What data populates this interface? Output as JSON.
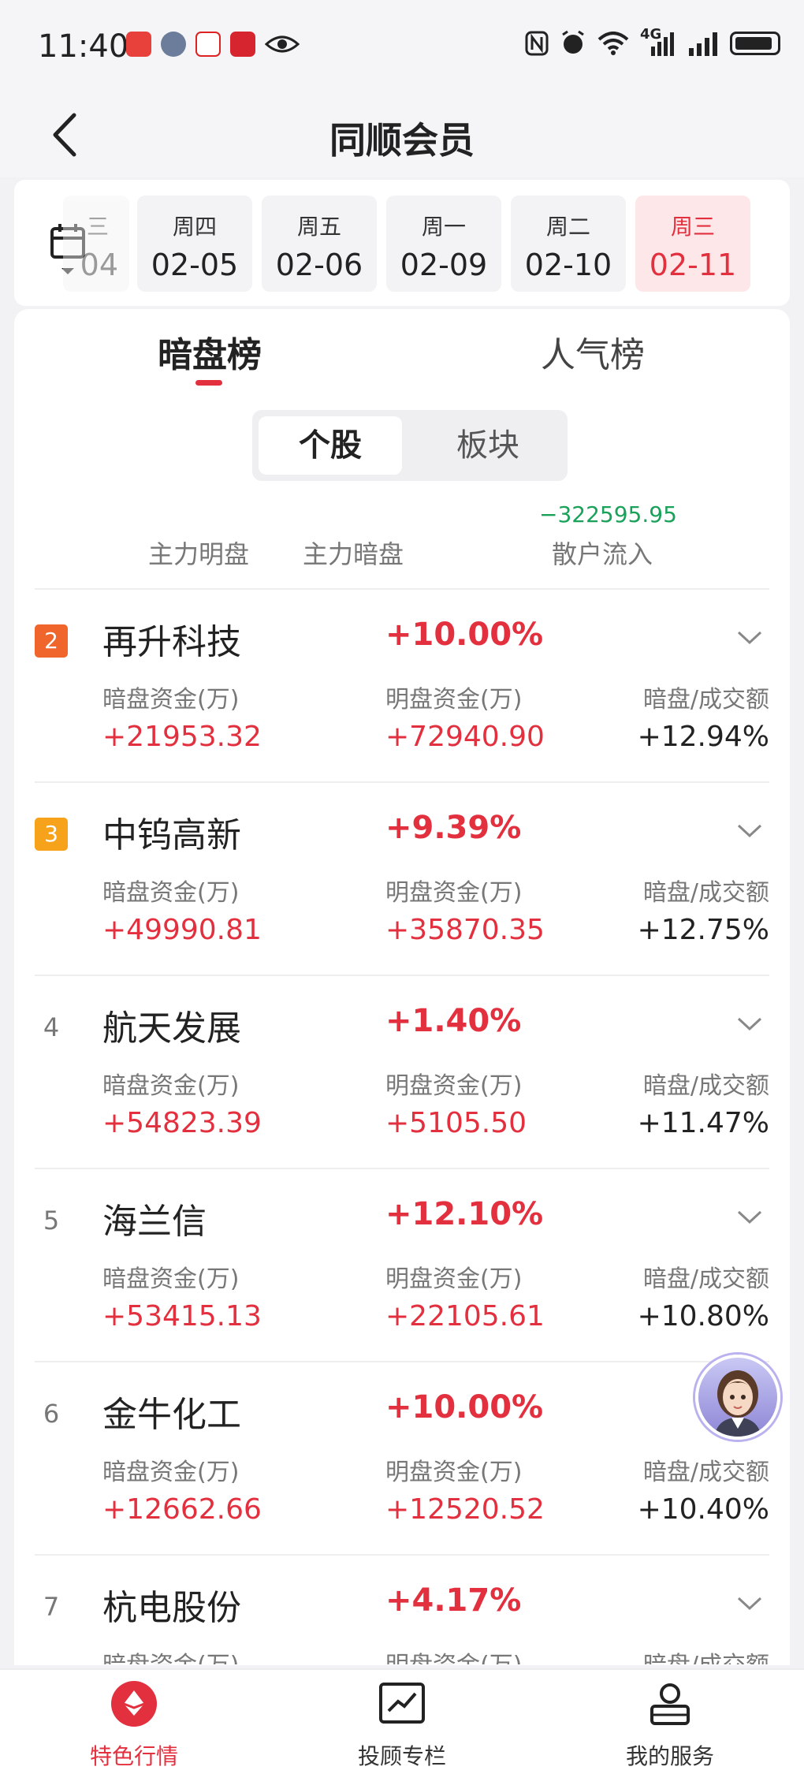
{
  "status_bar": {
    "time": "11:40",
    "network": "4G"
  },
  "header": {
    "title": "同顺会员"
  },
  "date_strip": {
    "dates": [
      {
        "dow": "三",
        "date": "04",
        "state": "partial"
      },
      {
        "dow": "周四",
        "date": "02-05",
        "state": "normal"
      },
      {
        "dow": "周五",
        "date": "02-06",
        "state": "normal"
      },
      {
        "dow": "周一",
        "date": "02-09",
        "state": "normal"
      },
      {
        "dow": "周二",
        "date": "02-10",
        "state": "normal"
      },
      {
        "dow": "周三",
        "date": "02-11",
        "state": "active"
      }
    ]
  },
  "tabs": {
    "dark_pool": "暗盘榜",
    "popularity": "人气榜"
  },
  "segment": {
    "stocks": "个股",
    "sectors": "板块"
  },
  "flow_summary": {
    "retail_value": "−322595.95",
    "main_ming_label": "主力明盘",
    "main_an_label": "主力暗盘",
    "retail_label": "散户流入"
  },
  "column_labels": {
    "dark_funds": "暗盘资金(万)",
    "open_funds": "明盘资金(万)",
    "dark_ratio": "暗盘/成交额"
  },
  "stocks": [
    {
      "rank": "2",
      "name": "再升科技",
      "pct": "+10.00%",
      "dark": "+21953.32",
      "open": "+72940.90",
      "ratio": "+12.94%"
    },
    {
      "rank": "3",
      "name": "中钨高新",
      "pct": "+9.39%",
      "dark": "+49990.81",
      "open": "+35870.35",
      "ratio": "+12.75%"
    },
    {
      "rank": "4",
      "name": "航天发展",
      "pct": "+1.40%",
      "dark": "+54823.39",
      "open": "+5105.50",
      "ratio": "+11.47%"
    },
    {
      "rank": "5",
      "name": "海兰信",
      "pct": "+12.10%",
      "dark": "+53415.13",
      "open": "+22105.61",
      "ratio": "+10.80%"
    },
    {
      "rank": "6",
      "name": "金牛化工",
      "pct": "+10.00%",
      "dark": "+12662.66",
      "open": "+12520.52",
      "ratio": "+10.40%"
    },
    {
      "rank": "7",
      "name": "杭电股份",
      "pct": "+4.17%",
      "dark": "",
      "open": "",
      "ratio": ""
    }
  ],
  "bottom_nav": {
    "feature": "特色行情",
    "column": "投顾专栏",
    "service": "我的服务"
  },
  "colors": {
    "accent": "#e3303f",
    "green": "#1aa15a",
    "rank2": "#f0652b",
    "rank3": "#f7a21b"
  }
}
